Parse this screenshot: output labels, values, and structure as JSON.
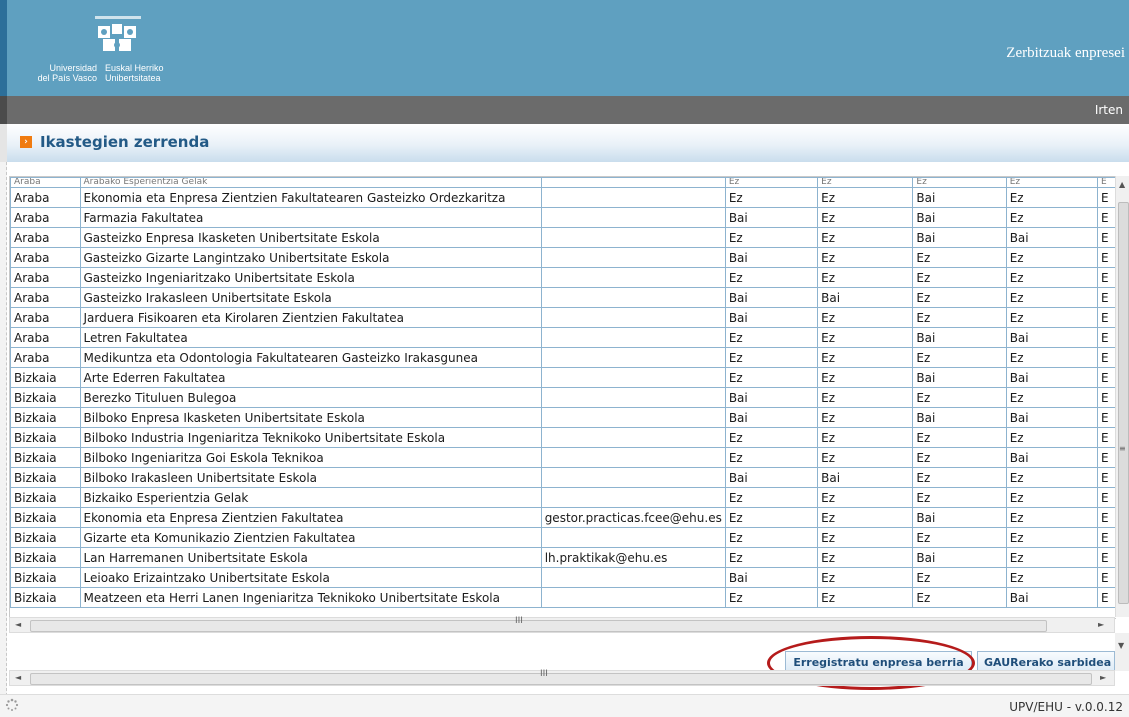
{
  "header": {
    "logo_line_es": "Universidad del País Vasco",
    "logo_line_eu": "Euskal Herriko Unibertsitatea",
    "service_title": "Zerbitzuak enpresei",
    "logout_label": "Irten"
  },
  "page": {
    "title": "Ikastegien zerrenda"
  },
  "table": {
    "partial_row": [
      "Araba",
      "Arabako Esperientzia Gelak",
      "",
      "Ez",
      "Ez",
      "Ez",
      "Ez",
      "E"
    ],
    "rows": [
      [
        "Araba",
        "Ekonomia eta Enpresa Zientzien Fakultatearen Gasteizko Ordezkaritza",
        "",
        "Ez",
        "Ez",
        "Bai",
        "Ez",
        "E"
      ],
      [
        "Araba",
        "Farmazia Fakultatea",
        "",
        "Bai",
        "Ez",
        "Bai",
        "Ez",
        "E"
      ],
      [
        "Araba",
        "Gasteizko Enpresa Ikasketen Unibertsitate Eskola",
        "",
        "Ez",
        "Ez",
        "Bai",
        "Bai",
        "E"
      ],
      [
        "Araba",
        "Gasteizko Gizarte Langintzako Unibertsitate Eskola",
        "",
        "Bai",
        "Ez",
        "Ez",
        "Ez",
        "E"
      ],
      [
        "Araba",
        "Gasteizko Ingeniaritzako Unibertsitate Eskola",
        "",
        "Ez",
        "Ez",
        "Ez",
        "Ez",
        "E"
      ],
      [
        "Araba",
        "Gasteizko Irakasleen Unibertsitate Eskola",
        "",
        "Bai",
        "Bai",
        "Ez",
        "Ez",
        "E"
      ],
      [
        "Araba",
        "Jarduera Fisikoaren eta Kirolaren Zientzien Fakultatea",
        "",
        "Bai",
        "Ez",
        "Ez",
        "Ez",
        "E"
      ],
      [
        "Araba",
        "Letren Fakultatea",
        "",
        "Ez",
        "Ez",
        "Bai",
        "Bai",
        "E"
      ],
      [
        "Araba",
        "Medikuntza eta Odontologia Fakultatearen Gasteizko Irakasgunea",
        "",
        "Ez",
        "Ez",
        "Ez",
        "Ez",
        "E"
      ],
      [
        "Bizkaia",
        "Arte Ederren Fakultatea",
        "",
        "Ez",
        "Ez",
        "Bai",
        "Bai",
        "E"
      ],
      [
        "Bizkaia",
        "Berezko Tituluen Bulegoa",
        "",
        "Bai",
        "Ez",
        "Ez",
        "Ez",
        "E"
      ],
      [
        "Bizkaia",
        "Bilboko Enpresa Ikasketen Unibertsitate Eskola",
        "",
        "Bai",
        "Ez",
        "Bai",
        "Bai",
        "E"
      ],
      [
        "Bizkaia",
        "Bilboko Industria Ingeniaritza Teknikoko Unibertsitate Eskola",
        "",
        "Ez",
        "Ez",
        "Ez",
        "Ez",
        "E"
      ],
      [
        "Bizkaia",
        "Bilboko Ingeniaritza Goi Eskola Teknikoa",
        "",
        "Ez",
        "Ez",
        "Ez",
        "Bai",
        "E"
      ],
      [
        "Bizkaia",
        "Bilboko Irakasleen Unibertsitate Eskola",
        "",
        "Bai",
        "Bai",
        "Ez",
        "Ez",
        "E"
      ],
      [
        "Bizkaia",
        "Bizkaiko Esperientzia Gelak",
        "",
        "Ez",
        "Ez",
        "Ez",
        "Ez",
        "E"
      ],
      [
        "Bizkaia",
        "Ekonomia eta Enpresa Zientzien Fakultatea",
        "gestor.practicas.fcee@ehu.es",
        "Ez",
        "Ez",
        "Bai",
        "Ez",
        "E"
      ],
      [
        "Bizkaia",
        "Gizarte eta Komunikazio Zientzien Fakultatea",
        "",
        "Ez",
        "Ez",
        "Ez",
        "Ez",
        "E"
      ],
      [
        "Bizkaia",
        "Lan Harremanen Unibertsitate Eskola",
        "lh.praktikak@ehu.es",
        "Ez",
        "Ez",
        "Bai",
        "Ez",
        "E"
      ],
      [
        "Bizkaia",
        "Leioako Erizaintzako Unibertsitate Eskola",
        "",
        "Bai",
        "Ez",
        "Ez",
        "Ez",
        "E"
      ],
      [
        "Bizkaia",
        "Meatzeen eta Herri Lanen Ingeniaritza Teknikoko Unibertsitate Eskola",
        "",
        "Ez",
        "Ez",
        "Ez",
        "Bai",
        "E"
      ]
    ]
  },
  "scroll": {
    "h_grip": "III",
    "v_grip": "≡",
    "left_arrow": "◄",
    "right_arrow": "►",
    "up_arrow": "▲",
    "down_arrow": "▼"
  },
  "actions": {
    "register_label": "Erregistratu enpresa berria",
    "gaur_label": "GAURerako sarbidea"
  },
  "footer": {
    "version": "UPV/EHU - v.0.0.12"
  },
  "colors": {
    "header_blue": "#5fa0c0",
    "nav_gray": "#6b6b6b",
    "title_blue": "#235a86",
    "bullet_orange": "#f07b10",
    "highlight_red": "#b51b1b",
    "cell_border": "#8db3cf"
  }
}
